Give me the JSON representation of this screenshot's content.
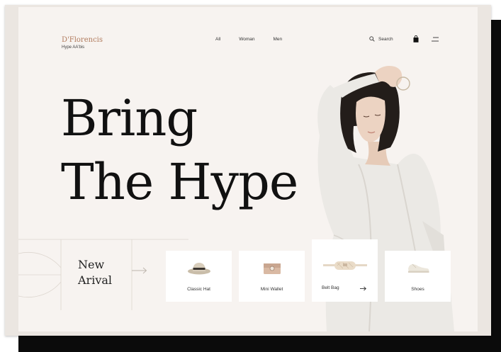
{
  "brand": {
    "name": "D'Florencis",
    "tagline": "Hype AA'bis"
  },
  "nav": {
    "items": [
      "All",
      "Woman",
      "Men"
    ]
  },
  "header": {
    "search_label": "Search",
    "icons": [
      "search-icon",
      "bag-icon",
      "menu-icon"
    ]
  },
  "hero": {
    "line1": "Bring",
    "line2": "The Hype"
  },
  "new_arrival": {
    "line1": "New",
    "line2": "Arival"
  },
  "products": [
    {
      "label": "Classic Hat",
      "icon": "hat-icon"
    },
    {
      "label": "Mini Wallet",
      "icon": "wallet-icon"
    },
    {
      "label": "Belt Bag",
      "icon": "belt-bag-icon"
    },
    {
      "label": "Shoes",
      "icon": "shoes-icon"
    }
  ],
  "colors": {
    "background": "#f7f3f0",
    "brand": "#b07a5c",
    "text": "#111111",
    "card": "#ffffff"
  }
}
